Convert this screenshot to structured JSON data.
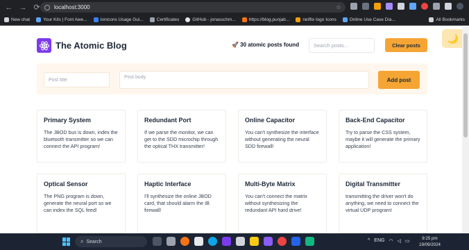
{
  "browser": {
    "url": "localhost:3000",
    "bookmarks": [
      {
        "label": "New chat",
        "color": "#d1d5db"
      },
      {
        "label": "Your Kits | Font Awe...",
        "color": "#60a5fa"
      },
      {
        "label": "Ionicons Usage Gui...",
        "color": "#3b82f6"
      },
      {
        "label": "Certificates",
        "color": "#9ca3af"
      },
      {
        "label": "GitHub - jonasschm...",
        "color": "#e5e7eb"
      },
      {
        "label": "https://blog.punjab...",
        "color": "#f97316"
      },
      {
        "label": "netflix logo Icons",
        "color": "#f59e0b"
      },
      {
        "label": "Online Use Case Dia...",
        "color": "#60a5fa"
      }
    ],
    "all_bookmarks_label": "All Bookmarks"
  },
  "header": {
    "brand": "The Atomic Blog",
    "post_count": "🚀 30 atomic posts found",
    "search_placeholder": "Search posts...",
    "clear_label": "Clear posts"
  },
  "form": {
    "title_placeholder": "Post title",
    "body_placeholder": "Post body",
    "add_label": "Add post"
  },
  "posts": [
    {
      "title": "Primary System",
      "body": "The JBOD bus is down, index the bluetooth transmitter so we can connect the API program!"
    },
    {
      "title": "Redundant Port",
      "body": "If we parse the monitor, we can get to the SDD microchip through the optical THX transmitter!"
    },
    {
      "title": "Online Capacitor",
      "body": "You can't synthesize the interface without generating the neural SDD firewall!"
    },
    {
      "title": "Back-End Capacitor",
      "body": "Try to parse the CSS system, maybe it will generate the primary application!"
    },
    {
      "title": "Optical Sensor",
      "body": "The PNG program is down, generate the neural port so we can index the SQL feed!"
    },
    {
      "title": "Haptic Interface",
      "body": "I'll synthesize the online JBOD card, that should alarm the IB firewall!"
    },
    {
      "title": "Multi-Byte Matrix",
      "body": "You can't connect the matrix without synthesizing the redundant API hard drive!"
    },
    {
      "title": "Digital Transmitter",
      "body": "transmitting the driver won't do anything, we need to connect the virtual UDP program!"
    }
  ],
  "taskbar": {
    "search_label": "Search",
    "time": "9:25 pm",
    "date": "19/09/2024",
    "lang": "ENG"
  },
  "colors": {
    "accent": "#f5a534",
    "brand": "#7c3aed",
    "form_bg": "#fff7ed"
  }
}
